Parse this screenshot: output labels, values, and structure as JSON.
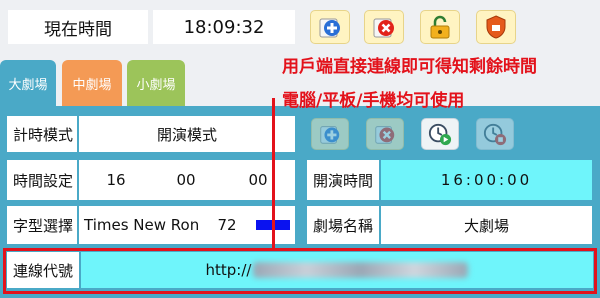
{
  "top": {
    "clock_label": "現在時間",
    "clock_value": "18:09:32"
  },
  "toolbar_icons": [
    "add-icon",
    "delete-icon",
    "unlock-icon",
    "shield-icon"
  ],
  "tabs": [
    {
      "label": "大劇場",
      "color": "#4aa9c7"
    },
    {
      "label": "中劇場",
      "color": "#f49a55"
    },
    {
      "label": "小劇場",
      "color": "#9cc45a"
    }
  ],
  "annotation": {
    "line1": "用戶端直接連線即可得知剩餘時間",
    "line2": "電腦/平板/手機均可使用",
    "color": "#e3121b"
  },
  "form": {
    "mode_label": "計時模式",
    "mode_value": "開演模式",
    "time_label": "時間設定",
    "hh": "16",
    "mm": "00",
    "ss": "00",
    "font_label": "字型選擇",
    "font_value": "Times New Ron",
    "font_size": "72",
    "start_label": "開演時間",
    "start_value": "16:00:00",
    "hall_label": "劇場名稱",
    "hall_value": "大劇場",
    "conn_label": "連線代號",
    "conn_prefix": "http://"
  },
  "panel_icons": [
    "add-icon",
    "delete-icon",
    "clock-play-icon",
    "clock-stop-icon"
  ]
}
